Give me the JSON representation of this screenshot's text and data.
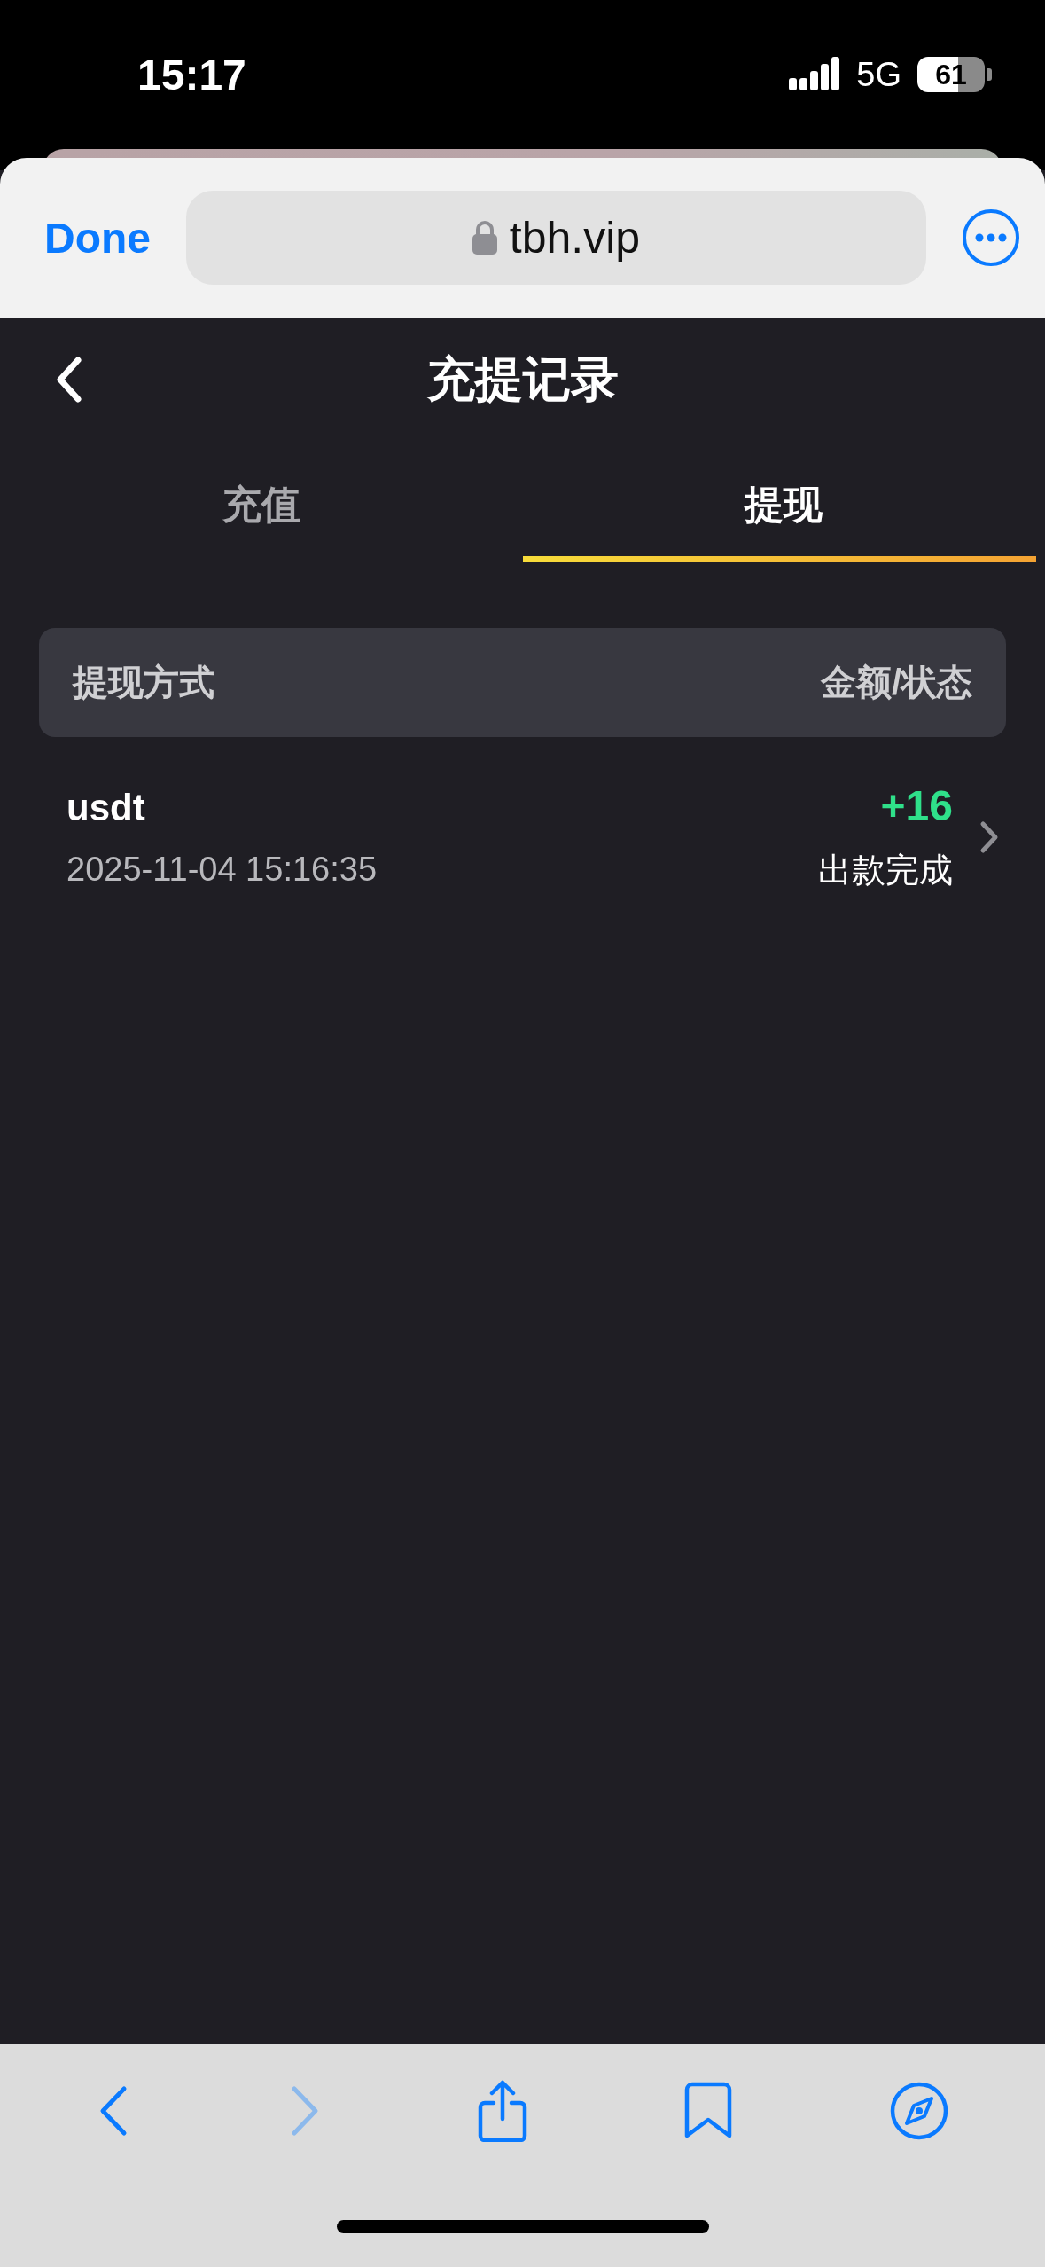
{
  "status_bar": {
    "time": "15:17",
    "network": "5G",
    "battery": "61"
  },
  "browser": {
    "done": "Done",
    "url": "tbh.vip"
  },
  "header": {
    "title": "充提记录"
  },
  "tabs": [
    {
      "label": "充值",
      "selected": false
    },
    {
      "label": "提现",
      "selected": true
    }
  ],
  "table": {
    "columns": [
      "提现方式",
      "金额/状态"
    ],
    "rows": [
      {
        "method": "usdt",
        "time": "2025-11-04 15:16:35",
        "amount": "+16",
        "status": "出款完成"
      }
    ]
  },
  "toolbar": {
    "back_disabled": false,
    "forward_disabled": true
  }
}
